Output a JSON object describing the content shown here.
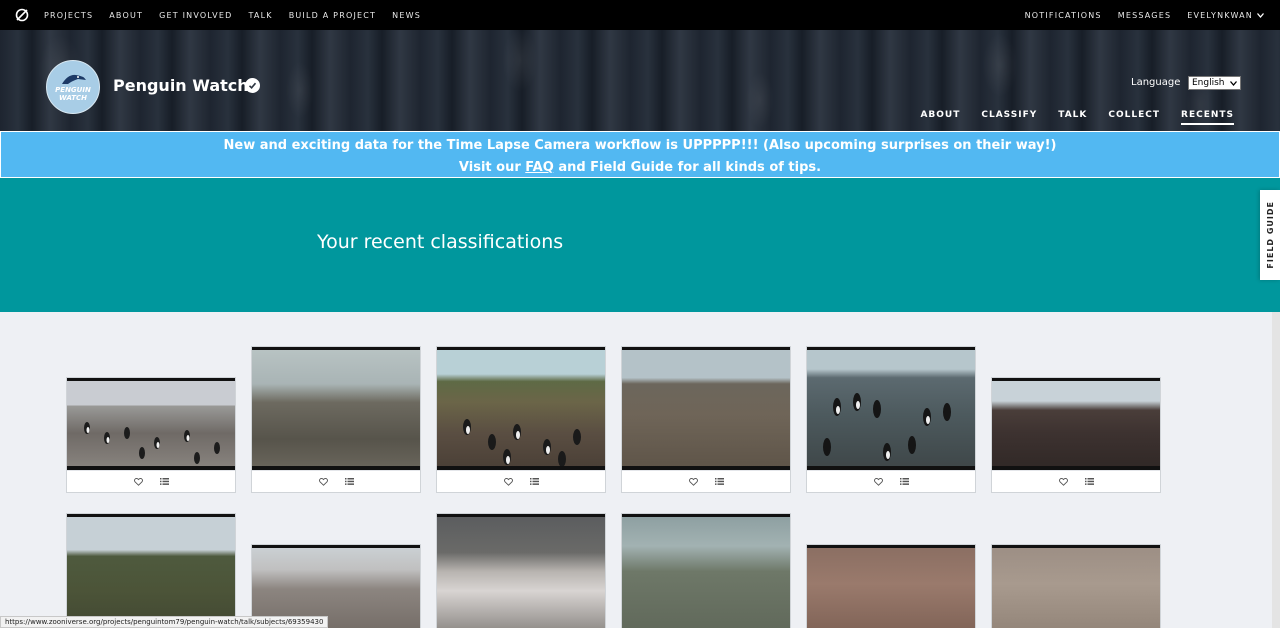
{
  "topnav": {
    "links": [
      "PROJECTS",
      "ABOUT",
      "GET INVOLVED",
      "TALK",
      "BUILD A PROJECT",
      "NEWS"
    ],
    "right_links": [
      "NOTIFICATIONS",
      "MESSAGES"
    ],
    "user": "EVELYNKWAN"
  },
  "project": {
    "avatar_text_1": "PENGUIN",
    "avatar_text_2": "WATCH",
    "title": "Penguin Watch",
    "language_label": "Language",
    "language_value": "English",
    "nav": [
      "ABOUT",
      "CLASSIFY",
      "TALK",
      "COLLECT",
      "RECENTS"
    ],
    "active_nav": "RECENTS"
  },
  "announcement": {
    "line1": "New and exciting data for the Time Lapse Camera workflow is UPPPPP!!! (Also upcoming surprises on their way!)",
    "line2_pre": "Visit our ",
    "line2_link": "FAQ",
    "line2_post": " and Field Guide for all kinds of tips."
  },
  "recents": {
    "title": "Your recent classifications",
    "field_guide": "FIELD GUIDE"
  },
  "status_url": "https://www.zooniverse.org/projects/penguintom79/penguin-watch/talk/subjects/69359430",
  "icons": {
    "heart": "heart-icon",
    "collect": "collect-list-icon",
    "logo": "zooniverse-logo-icon",
    "verified": "verified-check-icon"
  }
}
